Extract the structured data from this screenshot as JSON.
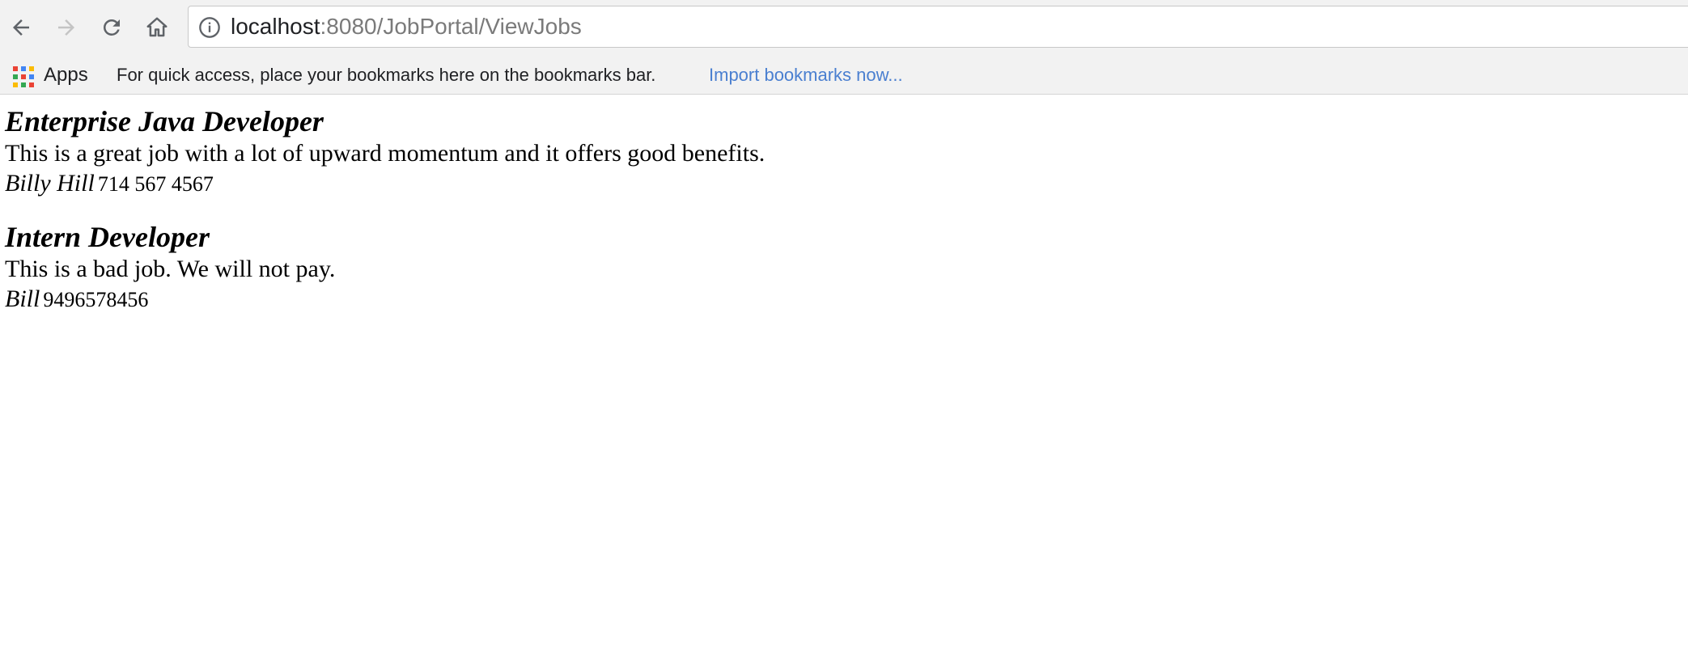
{
  "browser": {
    "url_host": "localhost",
    "url_path": ":8080/JobPortal/ViewJobs",
    "icons": {
      "back": "arrow-left-icon",
      "forward": "arrow-right-icon",
      "reload": "reload-icon",
      "home": "home-icon",
      "info": "info-icon",
      "apps": "apps-grid-icon"
    }
  },
  "bookmarks": {
    "apps_label": "Apps",
    "hint": "For quick access, place your bookmarks here on the bookmarks bar.",
    "import_link": "Import bookmarks now...",
    "link_color": "#4a7fd0"
  },
  "jobs": [
    {
      "title": "Enterprise Java Developer",
      "description": "This is a great job with a lot of upward momentum and it offers good benefits.",
      "contact_name": "Billy Hill",
      "contact_phone": "714 567 4567"
    },
    {
      "title": "Intern Developer",
      "description": "This is a bad job. We will not pay.",
      "contact_name": "Bill",
      "contact_phone": "9496578456"
    }
  ]
}
